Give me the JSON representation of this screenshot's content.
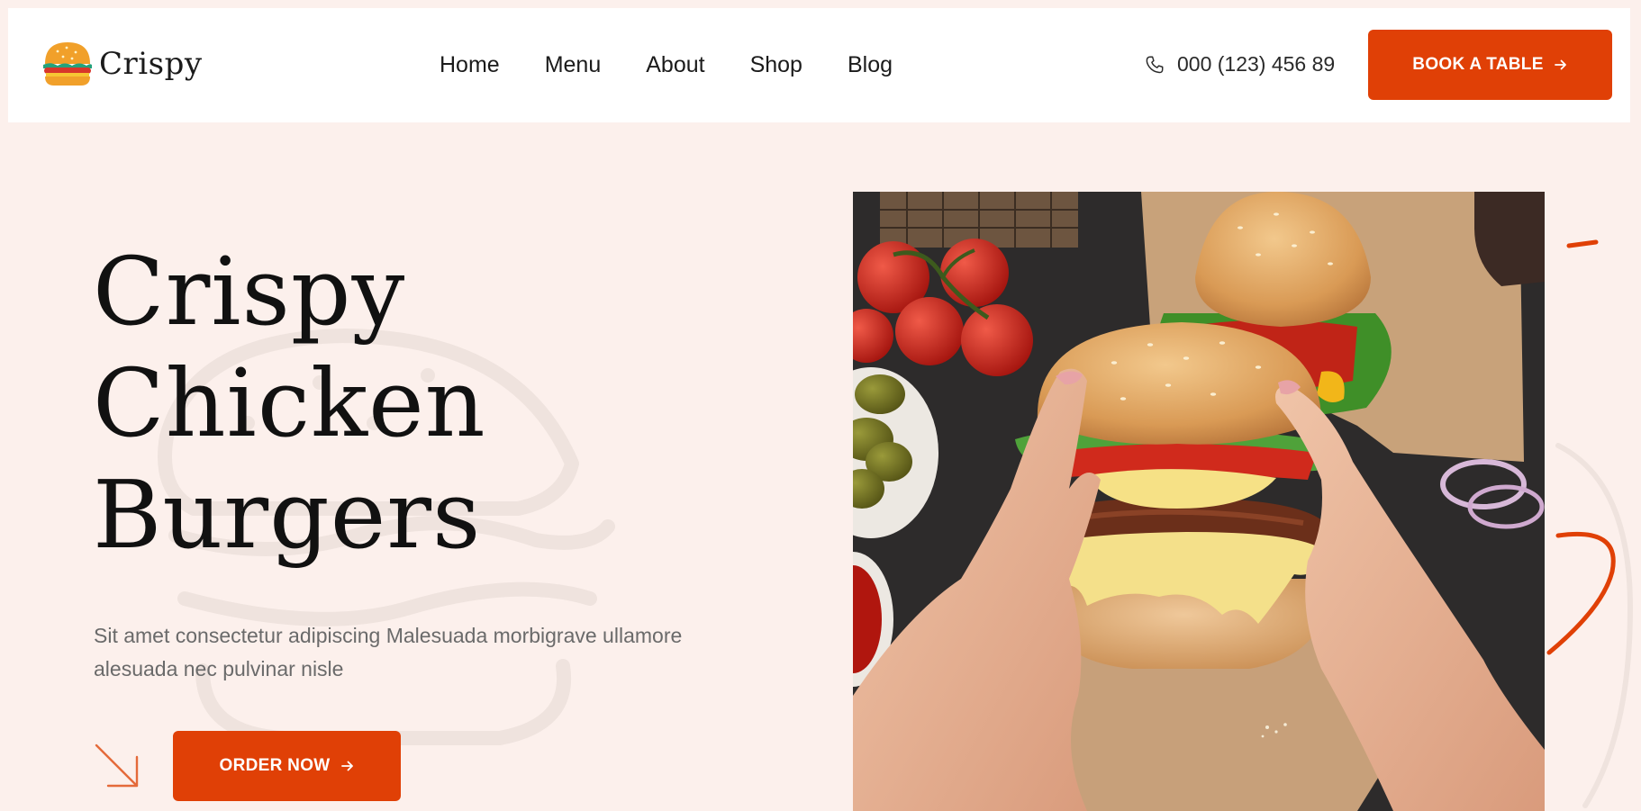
{
  "brand": {
    "name": "Crispy"
  },
  "nav": {
    "items": [
      {
        "label": "Home"
      },
      {
        "label": "Menu"
      },
      {
        "label": "About"
      },
      {
        "label": "Shop"
      },
      {
        "label": "Blog"
      }
    ]
  },
  "contact": {
    "phone": "000 (123) 456 89",
    "icon": "phone-icon"
  },
  "header": {
    "cta_label": "BOOK A TABLE"
  },
  "hero": {
    "title_lines": [
      "Crispy",
      "Chicken",
      "Burgers"
    ],
    "description": "Sit amet consectetur adipiscing Malesuada morbigrave ullamore alesuada nec pulvinar nisle",
    "cta_label": "ORDER NOW",
    "image": "burger-photo"
  },
  "colors": {
    "accent": "#e04006",
    "background": "#fcf0ec",
    "header_bg": "#ffffff",
    "text_dark": "#111111",
    "text_muted": "#6a6a6a"
  }
}
